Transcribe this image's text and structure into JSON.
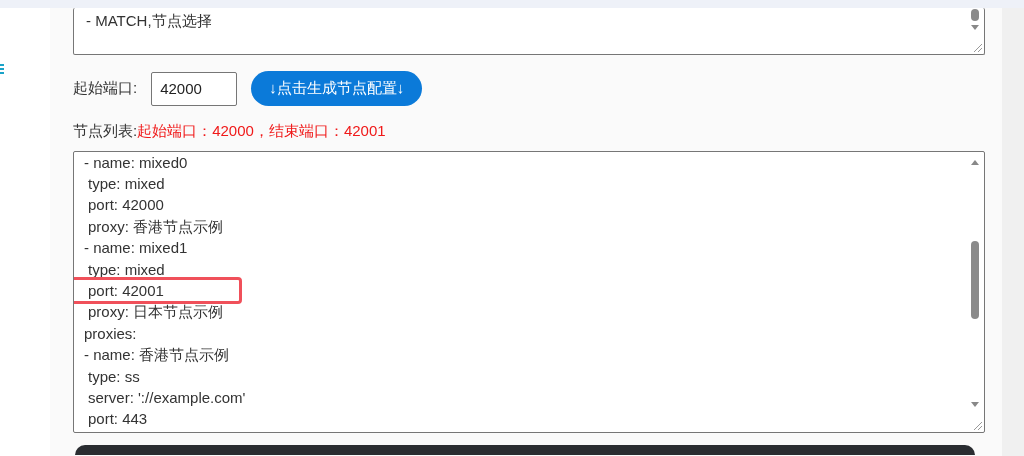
{
  "rules_box": {
    "lines": [
      "- MATCH,节点选择"
    ]
  },
  "port_form": {
    "label": "起始端口:",
    "value": "42000",
    "button": "↓点击生成节点配置↓"
  },
  "node_list": {
    "label": "节点列表:",
    "range": "起始端口：42000，结束端口：42001"
  },
  "config_box": {
    "lines": [
      {
        "text": "- name: mixed0",
        "indent": false,
        "highlighted": false
      },
      {
        "text": "type: mixed",
        "indent": true,
        "highlighted": false
      },
      {
        "text": "port: 42000",
        "indent": true,
        "highlighted": false
      },
      {
        "text": "proxy: 香港节点示例",
        "indent": true,
        "highlighted": false
      },
      {
        "text": "- name: mixed1",
        "indent": false,
        "highlighted": false
      },
      {
        "text": "type: mixed",
        "indent": true,
        "highlighted": false
      },
      {
        "text": "port: 42001",
        "indent": true,
        "highlighted": true
      },
      {
        "text": "proxy: 日本节点示例",
        "indent": true,
        "highlighted": false
      },
      {
        "text": "proxies:",
        "indent": false,
        "highlighted": false
      },
      {
        "text": "- name: 香港节点示例",
        "indent": false,
        "highlighted": false
      },
      {
        "text": "type: ss",
        "indent": true,
        "highlighted": false
      },
      {
        "text": "server: '://example.com'",
        "indent": true,
        "highlighted": false
      },
      {
        "text": "port: 443",
        "indent": true,
        "highlighted": false
      }
    ]
  }
}
